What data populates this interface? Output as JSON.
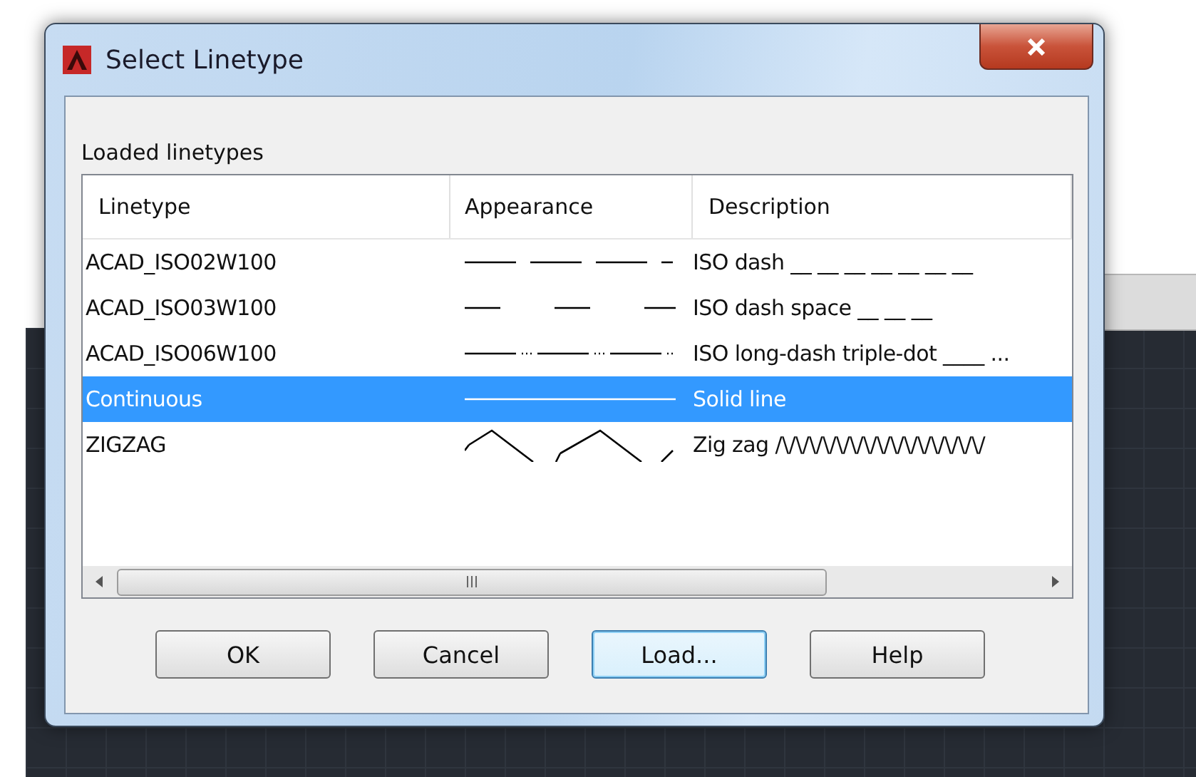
{
  "window": {
    "title": "Select Linetype"
  },
  "group_label": "Loaded linetypes",
  "table": {
    "columns": [
      "Linetype",
      "Appearance",
      "Description"
    ],
    "rows": [
      {
        "linetype": "ACAD_ISO02W100",
        "appearance": {
          "kind": "dash"
        },
        "description": "ISO dash __ __ __ __ __ __ __",
        "selected": false
      },
      {
        "linetype": "ACAD_ISO03W100",
        "appearance": {
          "kind": "dash-space"
        },
        "description": "ISO dash space __    __    __",
        "selected": false
      },
      {
        "linetype": "ACAD_ISO06W100",
        "appearance": {
          "kind": "long-dash-triple-dot"
        },
        "description": "ISO long-dash triple-dot ____ ...",
        "selected": false
      },
      {
        "linetype": "Continuous",
        "appearance": {
          "kind": "solid"
        },
        "description": "Solid line",
        "selected": true
      },
      {
        "linetype": "ZIGZAG",
        "appearance": {
          "kind": "zigzag"
        },
        "description": "Zig zag /\\/\\/\\/\\/\\/\\/\\/\\/\\/\\/\\/\\/\\/\\/\\/",
        "selected": false
      }
    ]
  },
  "buttons": [
    {
      "label": "OK",
      "focused": false
    },
    {
      "label": "Cancel",
      "focused": false
    },
    {
      "label": "Load...",
      "focused": true
    },
    {
      "label": "Help",
      "focused": false
    }
  ]
}
